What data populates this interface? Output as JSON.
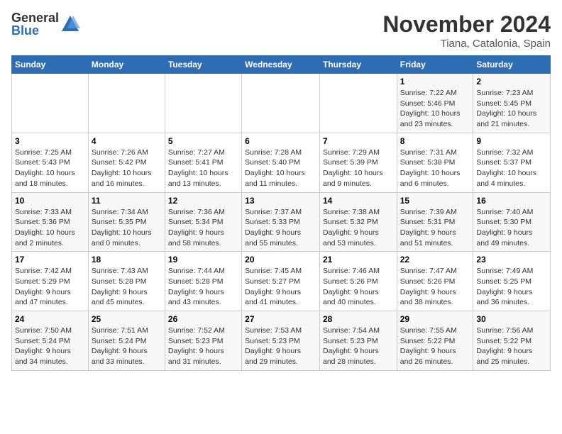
{
  "header": {
    "logo_general": "General",
    "logo_blue": "Blue",
    "month_title": "November 2024",
    "location": "Tiana, Catalonia, Spain"
  },
  "weekdays": [
    "Sunday",
    "Monday",
    "Tuesday",
    "Wednesday",
    "Thursday",
    "Friday",
    "Saturday"
  ],
  "weeks": [
    [
      {
        "day": "",
        "info": ""
      },
      {
        "day": "",
        "info": ""
      },
      {
        "day": "",
        "info": ""
      },
      {
        "day": "",
        "info": ""
      },
      {
        "day": "",
        "info": ""
      },
      {
        "day": "1",
        "info": "Sunrise: 7:22 AM\nSunset: 5:46 PM\nDaylight: 10 hours\nand 23 minutes."
      },
      {
        "day": "2",
        "info": "Sunrise: 7:23 AM\nSunset: 5:45 PM\nDaylight: 10 hours\nand 21 minutes."
      }
    ],
    [
      {
        "day": "3",
        "info": "Sunrise: 7:25 AM\nSunset: 5:43 PM\nDaylight: 10 hours\nand 18 minutes."
      },
      {
        "day": "4",
        "info": "Sunrise: 7:26 AM\nSunset: 5:42 PM\nDaylight: 10 hours\nand 16 minutes."
      },
      {
        "day": "5",
        "info": "Sunrise: 7:27 AM\nSunset: 5:41 PM\nDaylight: 10 hours\nand 13 minutes."
      },
      {
        "day": "6",
        "info": "Sunrise: 7:28 AM\nSunset: 5:40 PM\nDaylight: 10 hours\nand 11 minutes."
      },
      {
        "day": "7",
        "info": "Sunrise: 7:29 AM\nSunset: 5:39 PM\nDaylight: 10 hours\nand 9 minutes."
      },
      {
        "day": "8",
        "info": "Sunrise: 7:31 AM\nSunset: 5:38 PM\nDaylight: 10 hours\nand 6 minutes."
      },
      {
        "day": "9",
        "info": "Sunrise: 7:32 AM\nSunset: 5:37 PM\nDaylight: 10 hours\nand 4 minutes."
      }
    ],
    [
      {
        "day": "10",
        "info": "Sunrise: 7:33 AM\nSunset: 5:36 PM\nDaylight: 10 hours\nand 2 minutes."
      },
      {
        "day": "11",
        "info": "Sunrise: 7:34 AM\nSunset: 5:35 PM\nDaylight: 10 hours\nand 0 minutes."
      },
      {
        "day": "12",
        "info": "Sunrise: 7:36 AM\nSunset: 5:34 PM\nDaylight: 9 hours\nand 58 minutes."
      },
      {
        "day": "13",
        "info": "Sunrise: 7:37 AM\nSunset: 5:33 PM\nDaylight: 9 hours\nand 55 minutes."
      },
      {
        "day": "14",
        "info": "Sunrise: 7:38 AM\nSunset: 5:32 PM\nDaylight: 9 hours\nand 53 minutes."
      },
      {
        "day": "15",
        "info": "Sunrise: 7:39 AM\nSunset: 5:31 PM\nDaylight: 9 hours\nand 51 minutes."
      },
      {
        "day": "16",
        "info": "Sunrise: 7:40 AM\nSunset: 5:30 PM\nDaylight: 9 hours\nand 49 minutes."
      }
    ],
    [
      {
        "day": "17",
        "info": "Sunrise: 7:42 AM\nSunset: 5:29 PM\nDaylight: 9 hours\nand 47 minutes."
      },
      {
        "day": "18",
        "info": "Sunrise: 7:43 AM\nSunset: 5:28 PM\nDaylight: 9 hours\nand 45 minutes."
      },
      {
        "day": "19",
        "info": "Sunrise: 7:44 AM\nSunset: 5:28 PM\nDaylight: 9 hours\nand 43 minutes."
      },
      {
        "day": "20",
        "info": "Sunrise: 7:45 AM\nSunset: 5:27 PM\nDaylight: 9 hours\nand 41 minutes."
      },
      {
        "day": "21",
        "info": "Sunrise: 7:46 AM\nSunset: 5:26 PM\nDaylight: 9 hours\nand 40 minutes."
      },
      {
        "day": "22",
        "info": "Sunrise: 7:47 AM\nSunset: 5:26 PM\nDaylight: 9 hours\nand 38 minutes."
      },
      {
        "day": "23",
        "info": "Sunrise: 7:49 AM\nSunset: 5:25 PM\nDaylight: 9 hours\nand 36 minutes."
      }
    ],
    [
      {
        "day": "24",
        "info": "Sunrise: 7:50 AM\nSunset: 5:24 PM\nDaylight: 9 hours\nand 34 minutes."
      },
      {
        "day": "25",
        "info": "Sunrise: 7:51 AM\nSunset: 5:24 PM\nDaylight: 9 hours\nand 33 minutes."
      },
      {
        "day": "26",
        "info": "Sunrise: 7:52 AM\nSunset: 5:23 PM\nDaylight: 9 hours\nand 31 minutes."
      },
      {
        "day": "27",
        "info": "Sunrise: 7:53 AM\nSunset: 5:23 PM\nDaylight: 9 hours\nand 29 minutes."
      },
      {
        "day": "28",
        "info": "Sunrise: 7:54 AM\nSunset: 5:23 PM\nDaylight: 9 hours\nand 28 minutes."
      },
      {
        "day": "29",
        "info": "Sunrise: 7:55 AM\nSunset: 5:22 PM\nDaylight: 9 hours\nand 26 minutes."
      },
      {
        "day": "30",
        "info": "Sunrise: 7:56 AM\nSunset: 5:22 PM\nDaylight: 9 hours\nand 25 minutes."
      }
    ]
  ]
}
